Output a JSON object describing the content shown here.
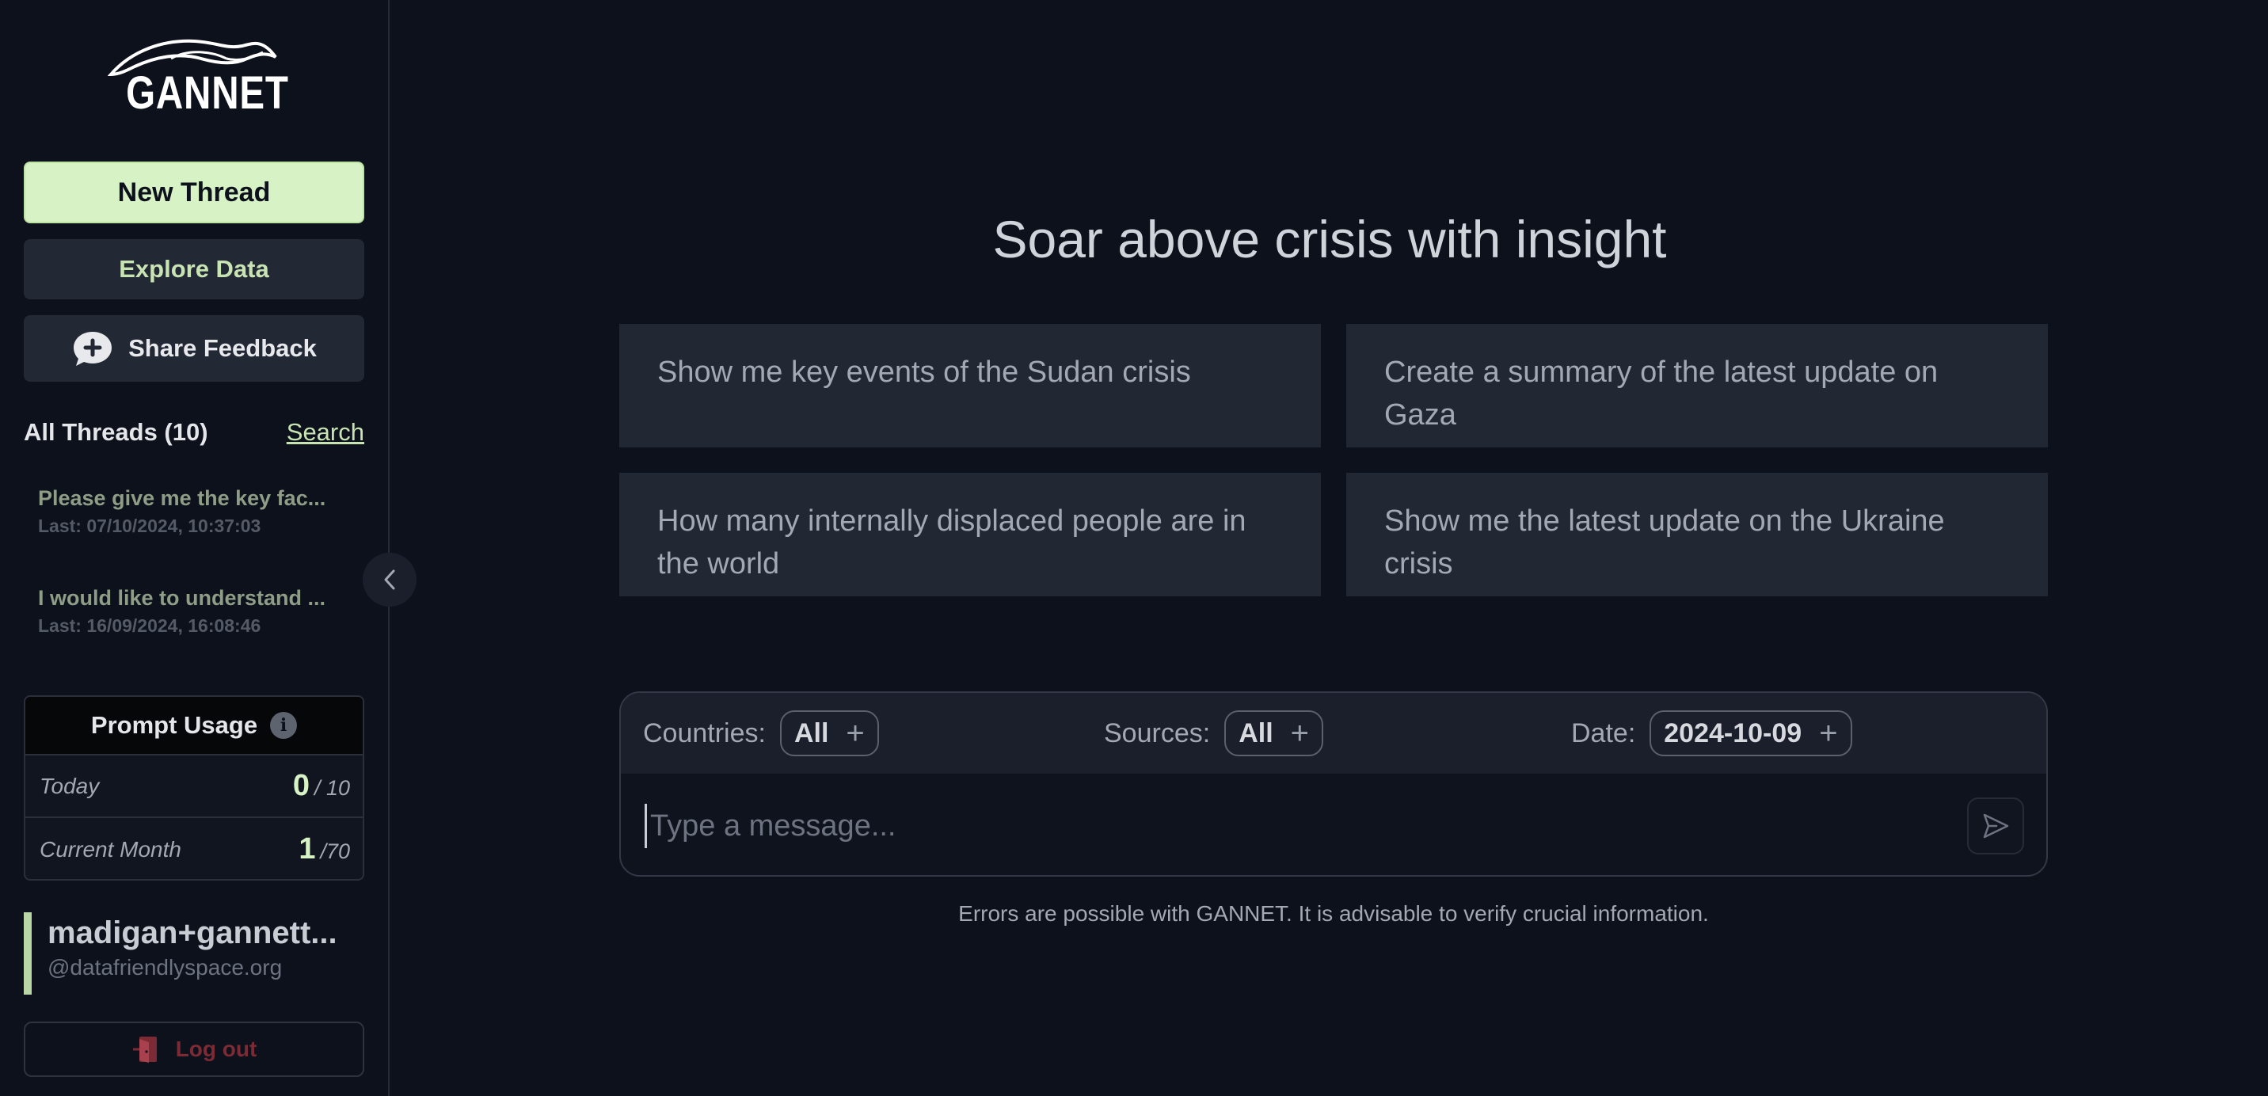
{
  "brand": {
    "logo_text": "GANNET"
  },
  "sidebar": {
    "new_thread": "New Thread",
    "explore_data": "Explore Data",
    "share_feedback": "Share Feedback",
    "threads_title": "All Threads (10)",
    "threads_search": "Search",
    "threads": [
      {
        "title": "Please give me the key fac...",
        "date": "Last: 07/10/2024, 10:37:03"
      },
      {
        "title": "I would like to understand ...",
        "date": "Last: 16/09/2024, 16:08:46"
      }
    ],
    "usage": {
      "title": "Prompt Usage",
      "rows": [
        {
          "label": "Today",
          "value": "0",
          "max": "/ 10"
        },
        {
          "label": "Current Month",
          "value": "1",
          "max": "/70"
        }
      ]
    },
    "user": {
      "name": "madigan+gannett...",
      "domain": "@datafriendlyspace.org"
    },
    "logout": "Log out"
  },
  "main": {
    "headline": "Soar above crisis with insight",
    "suggestions": [
      "Show me key events of the Sudan crisis",
      "Create a summary of the latest update on Gaza",
      "How many internally displaced people are in the world",
      "Show me the latest update on the Ukraine crisis"
    ],
    "filters": {
      "countries_label": "Countries:",
      "countries_value": "All",
      "sources_label": "Sources:",
      "sources_value": "All",
      "date_label": "Date:",
      "date_value": "2024-10-09",
      "add_symbol": "+"
    },
    "message_placeholder": "Type a message...",
    "disclaimer": "Errors are possible with GANNET. It is advisable to verify crucial information."
  },
  "colors": {
    "background": "#0d111c",
    "accent_green": "#d7f2c4",
    "card": "#222734",
    "logout_red": "#7c2a33"
  },
  "icons": [
    "bird-logo-icon",
    "chat-plus-icon",
    "chevron-left-icon",
    "info-icon",
    "logout-door-icon",
    "send-icon",
    "plus-icon"
  ]
}
